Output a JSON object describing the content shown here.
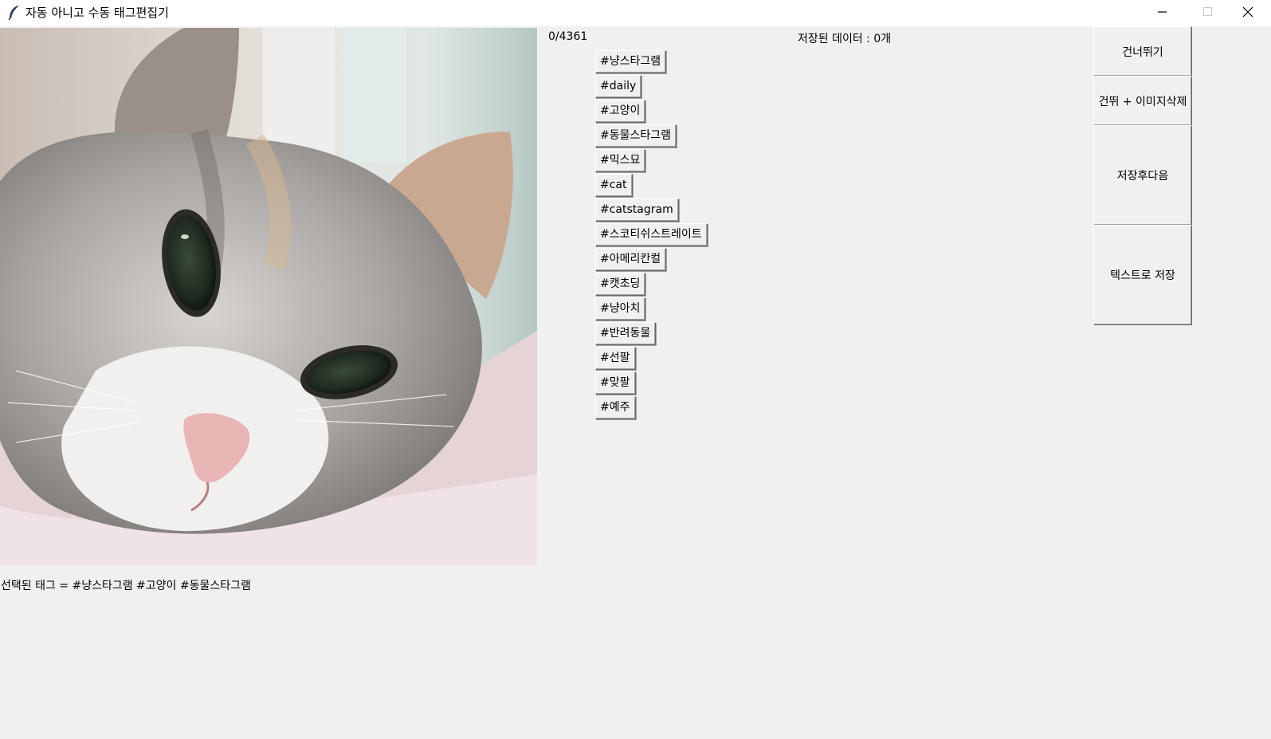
{
  "window": {
    "title": "자동 아니고 수동 태그편집기",
    "minimize_icon": "minimize-icon",
    "maximize_icon": "maximize-icon",
    "close_icon": "close-icon"
  },
  "status": {
    "counter": "0/4361",
    "saved_data": "저장된 데이터 : 0개"
  },
  "image": {
    "content": "cat-photo"
  },
  "tags": [
    "#냥스타그램",
    "#daily",
    "#고양이",
    "#동물스타그램",
    "#믹스묘",
    "#cat",
    "#catstagram",
    "#스코티쉬스트레이트",
    "#아메리칸컬",
    "#캣초딩",
    "#냥아치",
    "#반려동물",
    "#선팔",
    "#맞팔",
    "#예주"
  ],
  "actions": {
    "skip": "건너뛰기",
    "skip_delete": "건뛰 + 이미지삭제",
    "save_next": "저장후다음",
    "save_text": "텍스트로 저장"
  },
  "selected_tags": "선택된 태그 = #냥스타그램 #고양이 #동물스타그램"
}
